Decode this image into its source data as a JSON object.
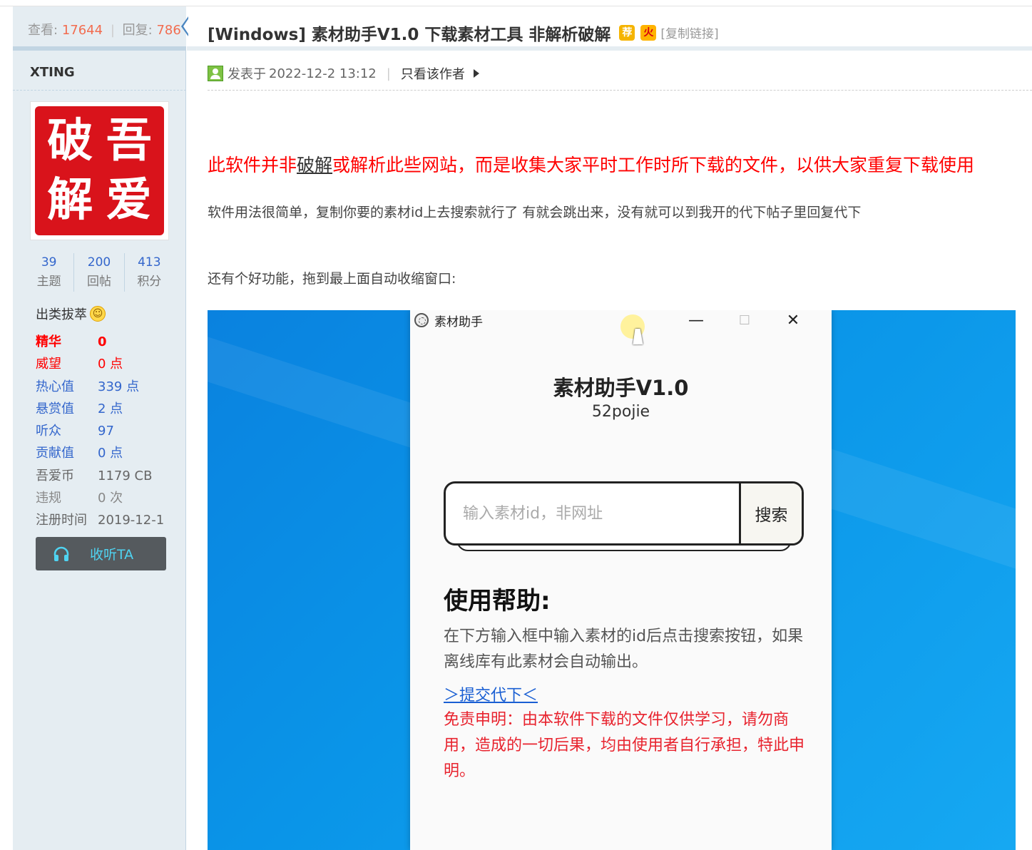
{
  "stats": {
    "views_label": "查看:",
    "views": "17644",
    "replies_label": "回复:",
    "replies": "786"
  },
  "thread": {
    "title": "[Windows] 素材助手V1.0 下载素材工具 非解析破解",
    "badge_recommend": "荐",
    "badge_hot": "火",
    "copy_link": "[复制链接]"
  },
  "author": {
    "name": "XTING",
    "avatar_chars": [
      "破",
      "吾",
      "解",
      "爱"
    ],
    "counts": [
      {
        "value": "39",
        "label": "主题"
      },
      {
        "value": "200",
        "label": "回帖"
      },
      {
        "value": "413",
        "label": "积分"
      }
    ],
    "group": "出类拔萃",
    "props": [
      {
        "key": "精华",
        "value": "0"
      },
      {
        "key": "威望",
        "value": "0 点"
      },
      {
        "key": "热心值",
        "value": "339 点"
      },
      {
        "key": "悬赏值",
        "value": "2 点"
      },
      {
        "key": "听众",
        "value": "97"
      },
      {
        "key": "贡献值",
        "value": "0 点"
      },
      {
        "key": "吾爱币",
        "value": "1179 CB"
      },
      {
        "key": "违规",
        "value": "0 次"
      },
      {
        "key": "注册时间",
        "value": "2019-12-1"
      }
    ],
    "follow_label": "收听TA"
  },
  "post": {
    "posted_prefix": "发表于",
    "posted_time": "2022-12-2 13:12",
    "meta_sep": "|",
    "only_author": "只看该作者",
    "red_line_pre": "此软件并非",
    "red_line_kw": "破解",
    "red_line_post": "或解析此些网站，而是收集大家平时工作时所下载的文件，以供大家重复下载使用",
    "para1": "软件用法很简单，复制你要的素材id上去搜索就行了 有就会跳出来，没有就可以到我开的代下帖子里回复代下",
    "para2": "还有个好功能，拖到最上面自动收缩窗口:"
  },
  "app": {
    "window_title": "素材助手",
    "minimize": "—",
    "maximize": "☐",
    "close": "✕",
    "name": "素材助手V1.0",
    "subtitle": "52pojie",
    "search_placeholder": "输入素材id，非网址",
    "search_button": "搜索",
    "help_title": "使用帮助:",
    "help_text": "在下方输入框中输入素材的id后点击搜索按钮，如果离线库有此素材会自动输出。",
    "submit_link": "＞提交代下＜",
    "disclaimer": "免责申明：由本软件下载的文件仅供学习，请勿商用，造成的一切后果，均由使用者自行承担，特此申明。"
  },
  "colors": {
    "accent_link": "#3366cc",
    "number_highlight": "#f26c4f",
    "warning_red": "#ff0000",
    "sidebar_bg": "#e5edf2",
    "desktop_blue": "#0a95e8"
  }
}
